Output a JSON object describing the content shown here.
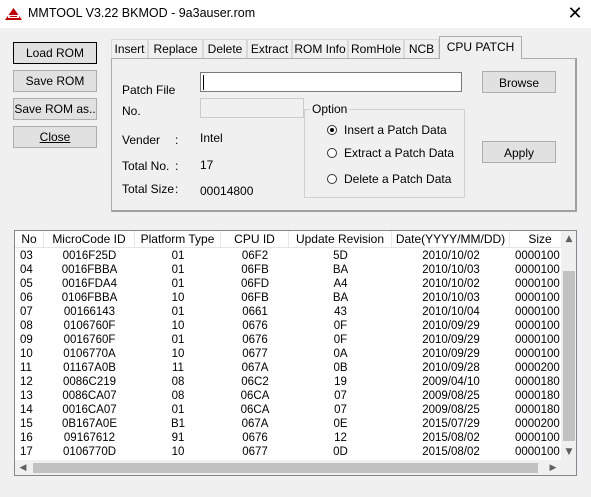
{
  "window": {
    "title": "MMTOOL V3.22 BKMOD - 9a3auser.rom",
    "close_glyph": "✕",
    "icon": "mmtool-app-icon"
  },
  "left_buttons": {
    "load": "Load ROM",
    "save": "Save ROM",
    "save_as": "Save ROM as..",
    "close": "Close"
  },
  "tabs": [
    "Insert",
    "Replace",
    "Delete",
    "Extract",
    "ROM Info",
    "RomHole",
    "NCB",
    "CPU PATCH"
  ],
  "active_tab": "CPU PATCH",
  "cpu_patch": {
    "patch_file_label": "Patch File",
    "patch_file_value": "",
    "no_label": "No.",
    "no_value": "",
    "vender_label": "Vender",
    "vender_colon": ":",
    "vender_value": "Intel",
    "total_no_label": "Total No.",
    "total_no_colon": ":",
    "total_no_value": "17",
    "total_size_label": "Total Size",
    "total_size_colon": ":",
    "total_size_value": "00014800",
    "browse": "Browse",
    "apply": "Apply",
    "option": {
      "title": "Option",
      "items": [
        "Insert a Patch Data",
        "Extract a Patch Data",
        "Delete a Patch Data"
      ],
      "selected": "Insert a Patch Data"
    }
  },
  "table": {
    "columns": [
      "No",
      "MicroCode ID",
      "Platform Type",
      "CPU ID",
      "Update Revision",
      "Date(YYYY/MM/DD)",
      "Size"
    ],
    "rows": [
      [
        "03",
        "0016F25D",
        "01",
        "06F2",
        "5D",
        "2010/10/02",
        "0000100"
      ],
      [
        "04",
        "0016FBBA",
        "01",
        "06FB",
        "BA",
        "2010/10/03",
        "0000100"
      ],
      [
        "05",
        "0016FDA4",
        "01",
        "06FD",
        "A4",
        "2010/10/02",
        "0000100"
      ],
      [
        "06",
        "0106FBBA",
        "10",
        "06FB",
        "BA",
        "2010/10/03",
        "0000100"
      ],
      [
        "07",
        "00166143",
        "01",
        "0661",
        "43",
        "2010/10/04",
        "0000100"
      ],
      [
        "08",
        "0106760F",
        "10",
        "0676",
        "0F",
        "2010/09/29",
        "0000100"
      ],
      [
        "09",
        "0016760F",
        "01",
        "0676",
        "0F",
        "2010/09/29",
        "0000100"
      ],
      [
        "10",
        "0106770A",
        "10",
        "0677",
        "0A",
        "2010/09/29",
        "0000100"
      ],
      [
        "11",
        "01167A0B",
        "11",
        "067A",
        "0B",
        "2010/09/28",
        "0000200"
      ],
      [
        "12",
        "0086C219",
        "08",
        "06C2",
        "19",
        "2009/04/10",
        "0000180"
      ],
      [
        "13",
        "0086CA07",
        "08",
        "06CA",
        "07",
        "2009/08/25",
        "0000180"
      ],
      [
        "14",
        "0016CA07",
        "01",
        "06CA",
        "07",
        "2009/08/25",
        "0000180"
      ],
      [
        "15",
        "0B167A0E",
        "B1",
        "067A",
        "0E",
        "2015/07/29",
        "0000200"
      ],
      [
        "16",
        "09167612",
        "91",
        "0676",
        "12",
        "2015/08/02",
        "0000100"
      ],
      [
        "17",
        "0106770D",
        "10",
        "0677",
        "0D",
        "2015/08/02",
        "0000100"
      ]
    ]
  },
  "scrollbars": {
    "up": "▲",
    "down": "▼",
    "left": "◀",
    "right": "▶"
  }
}
